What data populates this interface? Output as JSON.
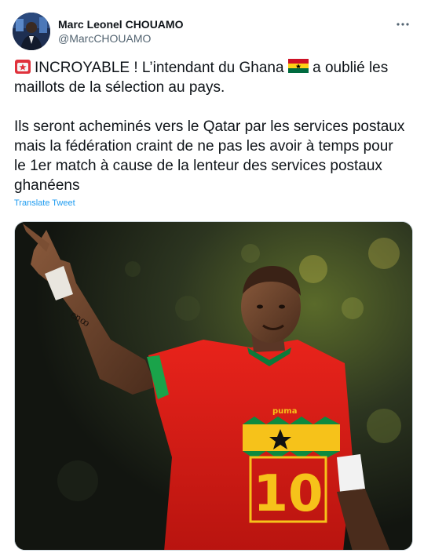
{
  "author": {
    "display_name": "Marc Leonel CHOUAMO",
    "handle": "@MarcCHOUAMO"
  },
  "tweet": {
    "paragraphs": [
      {
        "emoji_start": "siren-emoji",
        "text_a": "INCROYABLE ! L’intendant du Ghana ",
        "emoji_mid": "ghana-flag-emoji",
        "text_b": " a oublié les maillots de la sélection au pays."
      },
      {
        "text": "Ils seront acheminés vers le Qatar par les services postaux mais la fédération craint de ne pas les avoir à temps pour le 1er match à cause de la lenteur des services postaux ghanéens"
      }
    ],
    "translate_label": "Translate Tweet"
  },
  "media": {
    "description_icon": "photo-footballer-red-jersey",
    "jersey_brand": "puma",
    "jersey_number": "10"
  },
  "colors": {
    "link": "#1d9bf0",
    "text": "#0f1419",
    "secondary": "#536471",
    "ghana_red": "#ce1126",
    "ghana_gold": "#fcd116",
    "ghana_green": "#006b3f"
  },
  "icons": {
    "more": "more-icon"
  }
}
